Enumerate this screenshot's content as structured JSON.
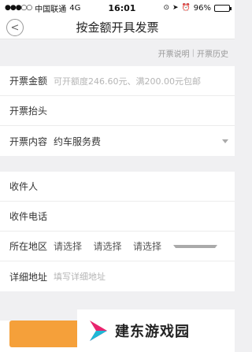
{
  "status_bar": {
    "carrier": "中国联通",
    "network": "4G",
    "time": "16:01",
    "battery_percent": "96%",
    "battery_level": 0.96
  },
  "nav": {
    "back_icon": "chevron-left-icon",
    "title": "按金额开具发票"
  },
  "links": {
    "invoice_help": "开票说明",
    "invoice_history": "开票历史",
    "separator": "|"
  },
  "invoice_section": {
    "amount_label": "开票金额",
    "amount_placeholder": "可开额度246.60元、满200.00元包邮",
    "header_label": "开票抬头",
    "content_label": "开票内容",
    "content_value": "约车服务费"
  },
  "address_section": {
    "recipient_label": "收件人",
    "phone_label": "收件电话",
    "region_label": "所在地区",
    "province_select": "请选择",
    "city_select": "请选择",
    "district_select": "请选择",
    "address_label": "详细地址",
    "address_placeholder": "填写详细地址"
  },
  "watermark": {
    "text": "建东游戏园"
  },
  "colors": {
    "accent": "#f5a03a",
    "logo_pink": "#e8246e",
    "logo_cyan": "#1fb8d6"
  }
}
